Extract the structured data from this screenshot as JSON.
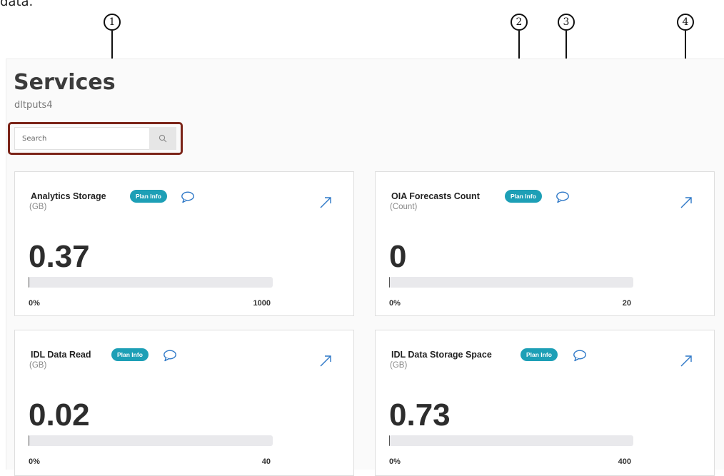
{
  "caption_fragment": "data.",
  "callouts": [
    "1",
    "2",
    "3",
    "4"
  ],
  "page": {
    "title": "Services",
    "subtitle": "dltputs4"
  },
  "search": {
    "placeholder": "Search",
    "value": "",
    "icon": "search-icon"
  },
  "colors": {
    "badge": "#1d9fb6",
    "icon": "#2e78c7",
    "highlight": "#7b2418"
  },
  "cards": [
    {
      "name": "Analytics Storage",
      "unit": "(GB)",
      "value": "0.37",
      "min_label": "0%",
      "max_label": "1000",
      "usage_fraction": 0.00037,
      "badge": "Plan Info"
    },
    {
      "name": "OIA Forecasts Count",
      "unit": "(Count)",
      "value": "0",
      "min_label": "0%",
      "max_label": "20",
      "usage_fraction": 0,
      "badge": "Plan Info"
    },
    {
      "name": "IDL Data Read",
      "unit": "(GB)",
      "value": "0.02",
      "min_label": "0%",
      "max_label": "40",
      "usage_fraction": 0.0005,
      "badge": "Plan Info"
    },
    {
      "name": "IDL Data Storage Space",
      "unit": "(GB)",
      "value": "0.73",
      "min_label": "0%",
      "max_label": "400",
      "usage_fraction": 0.0018,
      "badge": "Plan Info"
    }
  ]
}
